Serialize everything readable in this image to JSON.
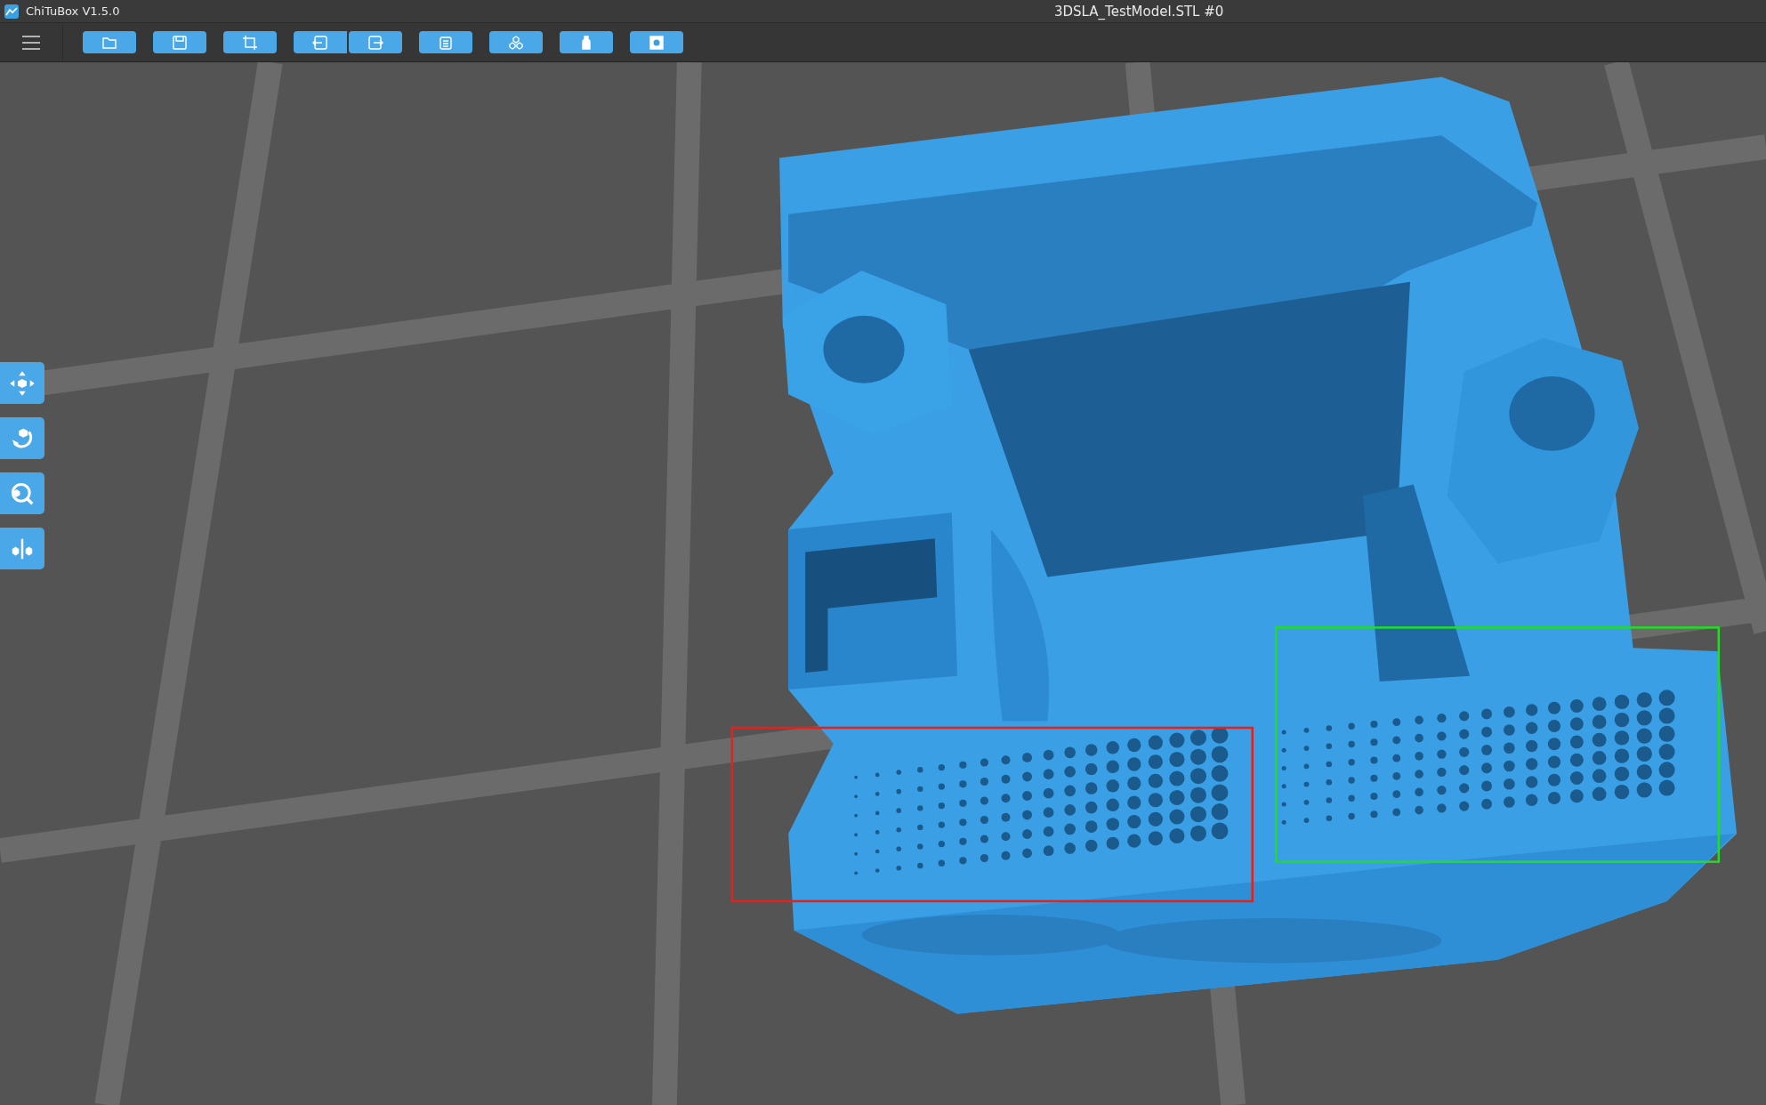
{
  "window": {
    "app_title": "ChiTuBox V1.5.0",
    "file_title": "3DSLA_TestModel.STL #0"
  },
  "toolbar": [
    {
      "kind": "open",
      "joined": false
    },
    {
      "kind": "save",
      "joined": false
    },
    {
      "kind": "crop",
      "joined": false
    },
    {
      "kind": "import",
      "joined": true
    },
    {
      "kind": "export",
      "joined": false
    },
    {
      "kind": "document",
      "joined": false
    },
    {
      "kind": "models",
      "joined": false
    },
    {
      "kind": "bottle",
      "joined": false
    },
    {
      "kind": "square",
      "joined": false
    }
  ],
  "side_tools": [
    {
      "kind": "move"
    },
    {
      "kind": "rotate"
    },
    {
      "kind": "zoom"
    },
    {
      "kind": "mirror"
    }
  ],
  "frames": [
    {
      "color": "#e8201c"
    },
    {
      "color": "#22dd22"
    }
  ]
}
